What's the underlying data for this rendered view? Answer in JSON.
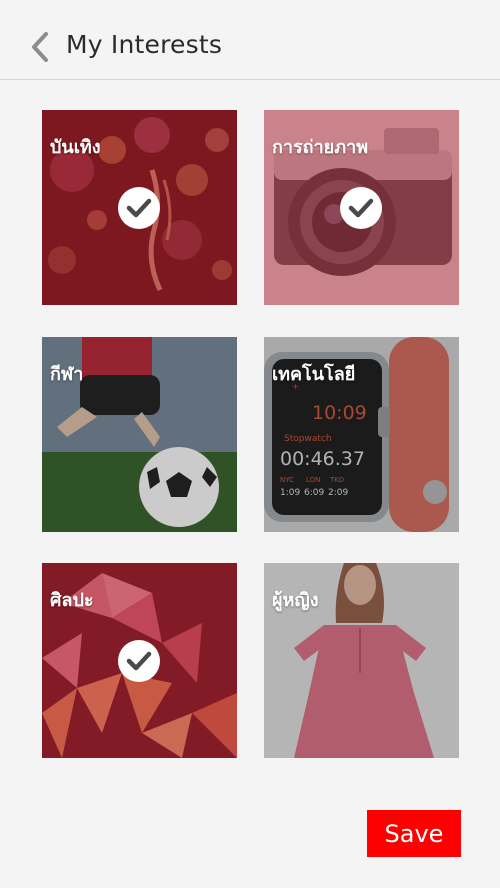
{
  "header": {
    "title": "My Interests"
  },
  "interests": [
    {
      "label": "บันเทิง",
      "selected": true,
      "icon": "entertainment-lights-image"
    },
    {
      "label": "การถ่ายภาพ",
      "selected": true,
      "icon": "camera-image"
    },
    {
      "label": "กีฬา",
      "selected": false,
      "icon": "soccer-image"
    },
    {
      "label": "เทคโนโลยี",
      "selected": false,
      "icon": "smartwatch-image"
    },
    {
      "label": "ศิลปะ",
      "selected": true,
      "icon": "origami-art-image"
    },
    {
      "label": "ผู้หญิง",
      "selected": false,
      "icon": "woman-fashion-image"
    }
  ],
  "actions": {
    "save_label": "Save"
  },
  "colors": {
    "accent": "#ff0000",
    "selected_overlay": "#a8212a",
    "unselected_overlay": "#5a5a5a",
    "background": "#f4f4f4"
  },
  "watch_display": {
    "time": "10:09",
    "mode": "Stopwatch",
    "counter": "00:46.37",
    "cities": [
      "NYC",
      "LON",
      "TKO"
    ],
    "city_times": [
      "1:09",
      "6:09",
      "2:09"
    ]
  }
}
